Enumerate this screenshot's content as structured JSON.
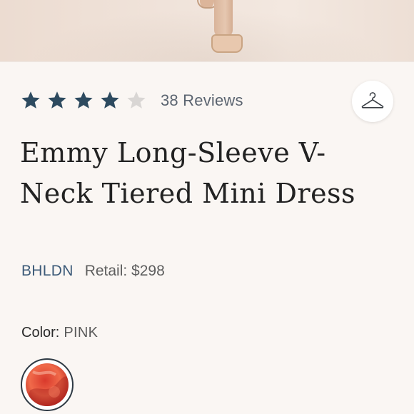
{
  "product": {
    "rating": {
      "value": 4,
      "max": 5,
      "filled_color": "#2d4a5f",
      "empty_color": "#d9d6d4",
      "reviews_label": "38 Reviews"
    },
    "title": "Emmy Long-Sleeve V-Neck Tiered Mini Dress",
    "brand": "BHLDN",
    "retail_label": "Retail: $298",
    "color": {
      "label": "Color:",
      "value": "PINK",
      "swatch_colors": [
        "#d9392c",
        "#f06a4a",
        "#b8261f"
      ]
    }
  },
  "icons": {
    "hanger": "hanger-icon",
    "star": "star-icon"
  }
}
